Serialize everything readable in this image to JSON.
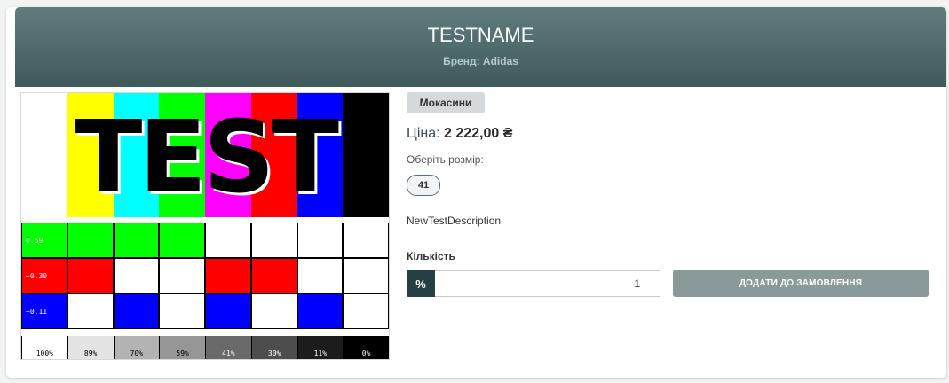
{
  "header": {
    "title": "TESTNAME",
    "brand": "Бренд: Adidas"
  },
  "image": {
    "alt_text": "TEST",
    "bar_colors": [
      "#ffffff",
      "#ffff00",
      "#00ffff",
      "#00ff00",
      "#ff00ff",
      "#ff0000",
      "#0000ff",
      "#000000"
    ],
    "row_labels": [
      "0.59",
      "+0.30",
      "+0.11"
    ],
    "gray_labels": [
      "100%",
      "89%",
      "70%",
      "59%",
      "41%",
      "30%",
      "11%",
      "0%"
    ]
  },
  "product": {
    "category": "Мокасини",
    "price_label": "Ціна: ",
    "price_value": "2 222,00 ₴",
    "size_prompt": "Оберіть розмір:",
    "sizes": [
      "41"
    ],
    "description": "NewTestDescription",
    "quantity_label": "Кількість",
    "quantity_icon": "%",
    "quantity_value": "1",
    "order_button": "ДОДАТИ ДО ЗАМОВЛЕННЯ"
  },
  "colors": {
    "header_top": "#607c7c",
    "header_bottom": "#3f5a5b",
    "qty_icon_bg": "#253f44",
    "button_bg": "#8a9a9b"
  }
}
